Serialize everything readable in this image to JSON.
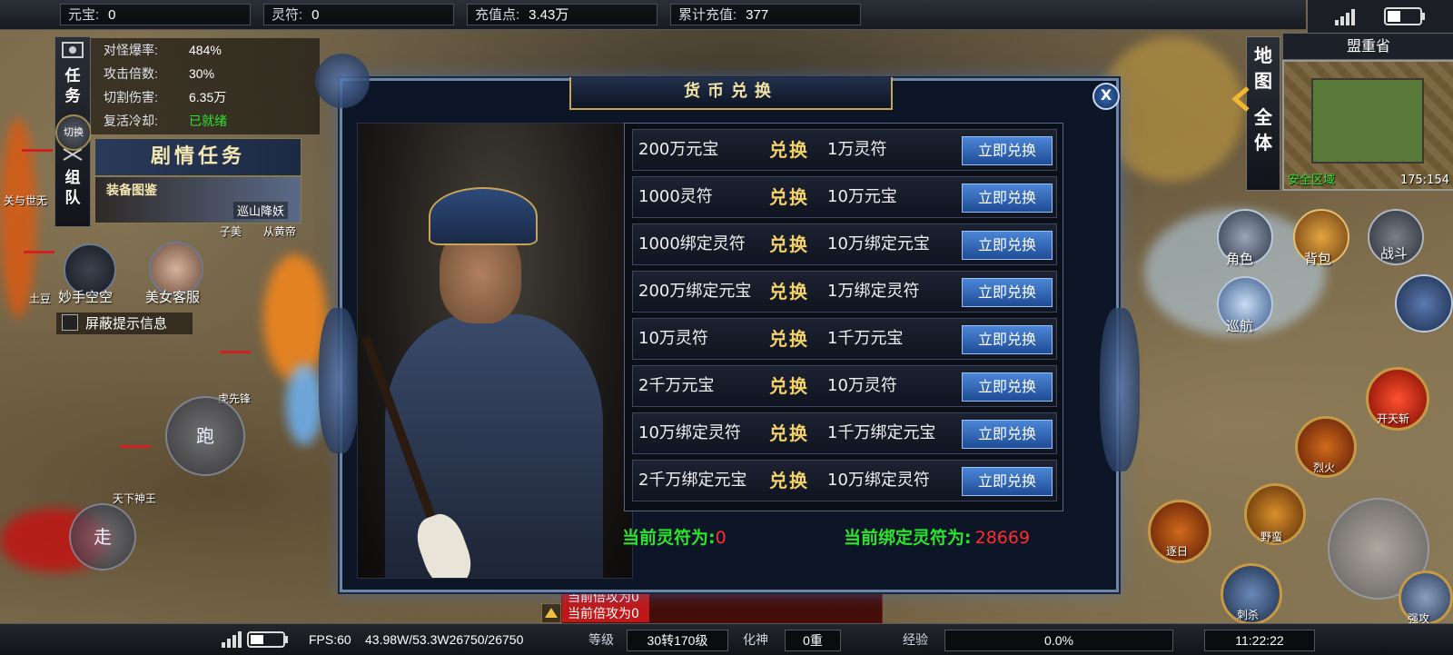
{
  "top_bar": {
    "resources": [
      {
        "label": "元宝:",
        "value": "0"
      },
      {
        "label": "灵符:",
        "value": "0"
      },
      {
        "label": "充值点:",
        "value": "3.43万"
      },
      {
        "label": "累计充值:",
        "value": "377"
      }
    ]
  },
  "left_stats": [
    {
      "label": "对怪爆率:",
      "value": "484%"
    },
    {
      "label": "攻击倍数:",
      "value": "30%"
    },
    {
      "label": "切割伤害:",
      "value": "6.35万"
    },
    {
      "label": "复活冷却:",
      "value": "已就绪"
    }
  ],
  "left_tabs": {
    "task": "任务",
    "switch": "切换",
    "team": "组队"
  },
  "quest_banner": "剧情任务",
  "equip_banner": {
    "title": "装备图鉴",
    "subtitle": "巡山降妖"
  },
  "left_buttons": {
    "skill1": "妙手空空",
    "skill2": "美女客服",
    "mask": "屏蔽提示信息",
    "run": "跑",
    "walk": "走"
  },
  "npc_labels": [
    "子美",
    "从黄帝",
    "关与世无",
    "土豆",
    "虎先锋",
    "天下神王"
  ],
  "map_tabs": {
    "map": "地图",
    "all": "全体"
  },
  "minimap": {
    "title": "盟重省",
    "zone": "安全区域",
    "coord": "175:154"
  },
  "right_buttons": {
    "role": "角色",
    "bag": "背包",
    "battle": "战斗",
    "patrol": "巡航"
  },
  "skills": [
    "开天斩",
    "烈火",
    "野蛮",
    "逐日",
    "刺杀",
    "强攻"
  ],
  "dialog": {
    "title": "货币兑换",
    "close": "X",
    "rows": [
      {
        "from": "200万元宝",
        "verb": "兑换",
        "to": "1万灵符",
        "button": "立即兑换"
      },
      {
        "from": "1000灵符",
        "verb": "兑换",
        "to": "10万元宝",
        "button": "立即兑换"
      },
      {
        "from": "1000绑定灵符",
        "verb": "兑换",
        "to": "10万绑定元宝",
        "button": "立即兑换"
      },
      {
        "from": "200万绑定元宝",
        "verb": "兑换",
        "to": "1万绑定灵符",
        "button": "立即兑换"
      },
      {
        "from": "10万灵符",
        "verb": "兑换",
        "to": "1千万元宝",
        "button": "立即兑换"
      },
      {
        "from": "2千万元宝",
        "verb": "兑换",
        "to": "10万灵符",
        "button": "立即兑换"
      },
      {
        "from": "10万绑定灵符",
        "verb": "兑换",
        "to": "1千万绑定元宝",
        "button": "立即兑换"
      },
      {
        "from": "2千万绑定元宝",
        "verb": "兑换",
        "to": "10万绑定灵符",
        "button": "立即兑换"
      }
    ],
    "footer": {
      "lingfu_label": "当前灵符为:",
      "lingfu_value": "0",
      "bound_label": "当前绑定灵符为:",
      "bound_value": "28669"
    }
  },
  "chat": [
    "当前倍攻为0",
    "当前倍攻为0"
  ],
  "bottom_bar": {
    "fps": "FPS:60",
    "hp_mp": "43.98W/53.3W26750/26750",
    "level_label": "等级",
    "level_value": "30转170级",
    "transform_label": "化神",
    "transform_value": "0重",
    "exp_label": "经验",
    "exp_value": "0.0%",
    "time": "11:22:22"
  },
  "colors": {
    "ready": "#2ee32e",
    "highlight_red": "#ff2d2d",
    "gold_verb": "#f4d06a",
    "button_blue": "#2f66b8"
  }
}
